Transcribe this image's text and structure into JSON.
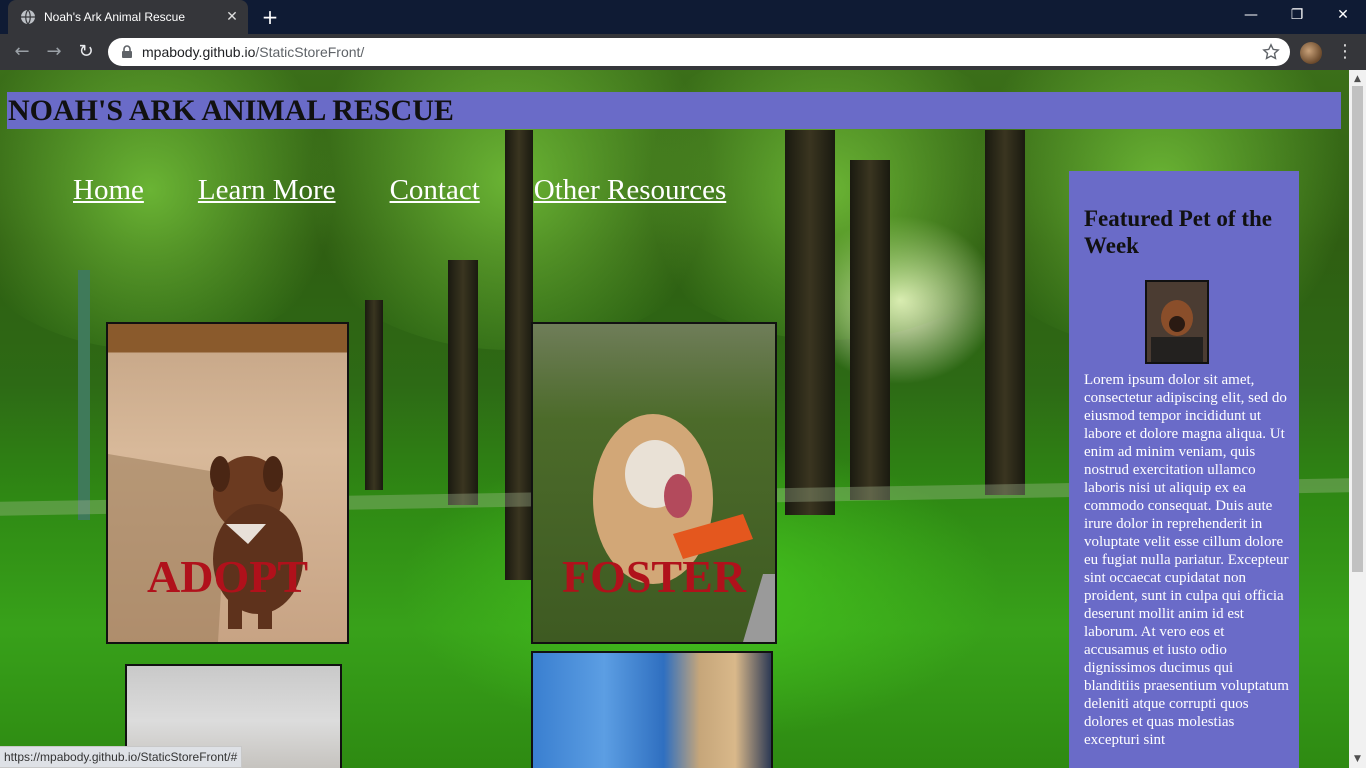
{
  "browser": {
    "tab_title": "Noah's Ark Animal Rescue",
    "tab_close": "✕",
    "new_tab": "+",
    "url_host": "mpabody.github.io",
    "url_path": "/StaticStoreFront/",
    "back": "←",
    "forward": "→",
    "reload": "↻",
    "minimize": "—",
    "restore": "❐",
    "close": "✕",
    "menu": "⋮",
    "status_url": "https://mpabody.github.io/StaticStoreFront/#"
  },
  "header": {
    "title": "NOAH'S ARK ANIMAL RESCUE"
  },
  "nav": {
    "items": [
      {
        "label": "Home"
      },
      {
        "label": "Learn More"
      },
      {
        "label": "Contact"
      },
      {
        "label": "Other Resources"
      }
    ]
  },
  "cards": {
    "adopt": {
      "label": "ADOPT"
    },
    "foster": {
      "label": "FOSTER"
    }
  },
  "featured": {
    "heading": "Featured Pet of the Week",
    "text": "Lorem ipsum dolor sit amet, consectetur adipiscing elit, sed do eiusmod tempor incididunt ut labore et dolore magna aliqua. Ut enim ad minim veniam, quis nostrud exercitation ullamco laboris nisi ut aliquip ex ea commodo consequat. Duis aute irure dolor in reprehenderit in voluptate velit esse cillum dolore eu fugiat nulla pariatur. Excepteur sint occaecat cupidatat non proident, sunt in culpa qui officia deserunt mollit anim id est laborum. At vero eos et accusamus et iusto odio dignissimos ducimus qui blanditiis praesentium voluptatum deleniti atque corrupti quos dolores et quas molestias excepturi sint"
  },
  "colors": {
    "header_bg": "#6a6bc8",
    "card_label": "#b0111b",
    "nav_link": "#ffffff"
  }
}
